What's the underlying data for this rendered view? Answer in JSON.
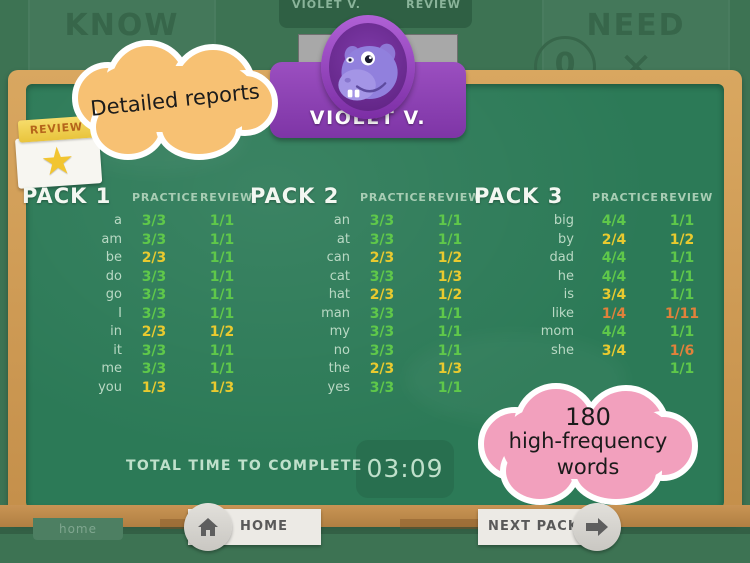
{
  "app": {
    "know_panel": {
      "label": "KNOW",
      "mark": "✓"
    },
    "need_panel": {
      "label": "NEED",
      "mark": "✕",
      "count": "0"
    },
    "tab_strip": {
      "left_label": "VIOLET V.",
      "right_label": "REVIEW"
    },
    "home_tab_label": "home"
  },
  "avatar": {
    "name": "VIOLET V.",
    "character": "hippo-avatar",
    "colors": {
      "plate": "#8a3fb0",
      "ring": "#9b4fc0"
    }
  },
  "sticker": {
    "band_label": "REVIEW",
    "icon": "star-icon"
  },
  "columns": {
    "practice": "PRACTICE",
    "review": "REVIEW"
  },
  "packs": [
    {
      "title": "PACK 1",
      "rows": [
        {
          "word": "a",
          "practice": "3/3",
          "practice_state": "good",
          "review": "1/1",
          "review_state": "good"
        },
        {
          "word": "am",
          "practice": "3/3",
          "practice_state": "good",
          "review": "1/1",
          "review_state": "good"
        },
        {
          "word": "be",
          "practice": "2/3",
          "practice_state": "mid",
          "review": "1/1",
          "review_state": "good"
        },
        {
          "word": "do",
          "practice": "3/3",
          "practice_state": "good",
          "review": "1/1",
          "review_state": "good"
        },
        {
          "word": "go",
          "practice": "3/3",
          "practice_state": "good",
          "review": "1/1",
          "review_state": "good"
        },
        {
          "word": "I",
          "practice": "3/3",
          "practice_state": "good",
          "review": "1/1",
          "review_state": "good"
        },
        {
          "word": "in",
          "practice": "2/3",
          "practice_state": "mid",
          "review": "1/2",
          "review_state": "mid"
        },
        {
          "word": "it",
          "practice": "3/3",
          "practice_state": "good",
          "review": "1/1",
          "review_state": "good"
        },
        {
          "word": "me",
          "practice": "3/3",
          "practice_state": "good",
          "review": "1/1",
          "review_state": "good"
        },
        {
          "word": "you",
          "practice": "1/3",
          "practice_state": "mid",
          "review": "1/3",
          "review_state": "mid"
        }
      ]
    },
    {
      "title": "PACK 2",
      "rows": [
        {
          "word": "an",
          "practice": "3/3",
          "practice_state": "good",
          "review": "1/1",
          "review_state": "good"
        },
        {
          "word": "at",
          "practice": "3/3",
          "practice_state": "good",
          "review": "1/1",
          "review_state": "good"
        },
        {
          "word": "can",
          "practice": "2/3",
          "practice_state": "mid",
          "review": "1/2",
          "review_state": "mid"
        },
        {
          "word": "cat",
          "practice": "3/3",
          "practice_state": "good",
          "review": "1/3",
          "review_state": "mid"
        },
        {
          "word": "hat",
          "practice": "2/3",
          "practice_state": "mid",
          "review": "1/2",
          "review_state": "mid"
        },
        {
          "word": "man",
          "practice": "3/3",
          "practice_state": "good",
          "review": "1/1",
          "review_state": "good"
        },
        {
          "word": "my",
          "practice": "3/3",
          "practice_state": "good",
          "review": "1/1",
          "review_state": "good"
        },
        {
          "word": "no",
          "practice": "3/3",
          "practice_state": "good",
          "review": "1/1",
          "review_state": "good"
        },
        {
          "word": "the",
          "practice": "2/3",
          "practice_state": "mid",
          "review": "1/3",
          "review_state": "mid"
        },
        {
          "word": "yes",
          "practice": "3/3",
          "practice_state": "good",
          "review": "1/1",
          "review_state": "good"
        }
      ]
    },
    {
      "title": "PACK 3",
      "rows": [
        {
          "word": "big",
          "practice": "4/4",
          "practice_state": "good",
          "review": "1/1",
          "review_state": "good"
        },
        {
          "word": "by",
          "practice": "2/4",
          "practice_state": "mid",
          "review": "1/2",
          "review_state": "mid"
        },
        {
          "word": "dad",
          "practice": "4/4",
          "practice_state": "good",
          "review": "1/1",
          "review_state": "good"
        },
        {
          "word": "he",
          "practice": "4/4",
          "practice_state": "good",
          "review": "1/1",
          "review_state": "good"
        },
        {
          "word": "is",
          "practice": "3/4",
          "practice_state": "mid",
          "review": "1/1",
          "review_state": "good"
        },
        {
          "word": "like",
          "practice": "1/4",
          "practice_state": "low",
          "review": "1/11",
          "review_state": "low"
        },
        {
          "word": "mom",
          "practice": "4/4",
          "practice_state": "good",
          "review": "1/1",
          "review_state": "good"
        },
        {
          "word": "she",
          "practice": "3/4",
          "practice_state": "mid",
          "review": "1/6",
          "review_state": "low"
        },
        {
          "word": "",
          "practice": "",
          "practice_state": "good",
          "review": "1/1",
          "review_state": "good"
        }
      ]
    }
  ],
  "total_time": {
    "label": "TOTAL TIME TO COMPLETE",
    "value": "03:09"
  },
  "buttons": {
    "home": {
      "label": "HOME",
      "icon": "house-icon"
    },
    "next_pack": {
      "label": "NEXT PACK",
      "icon": "arrow-right-icon"
    }
  },
  "callouts": {
    "orange": {
      "text": "Detailed reports",
      "color": "#f7c173"
    },
    "pink": {
      "line1": "180",
      "line2": "high-frequency",
      "line3": "words",
      "color": "#f2a0bd"
    }
  },
  "score_colors": {
    "good": "#5fc84a",
    "mid": "#e9ca2f",
    "low": "#e2813b"
  }
}
